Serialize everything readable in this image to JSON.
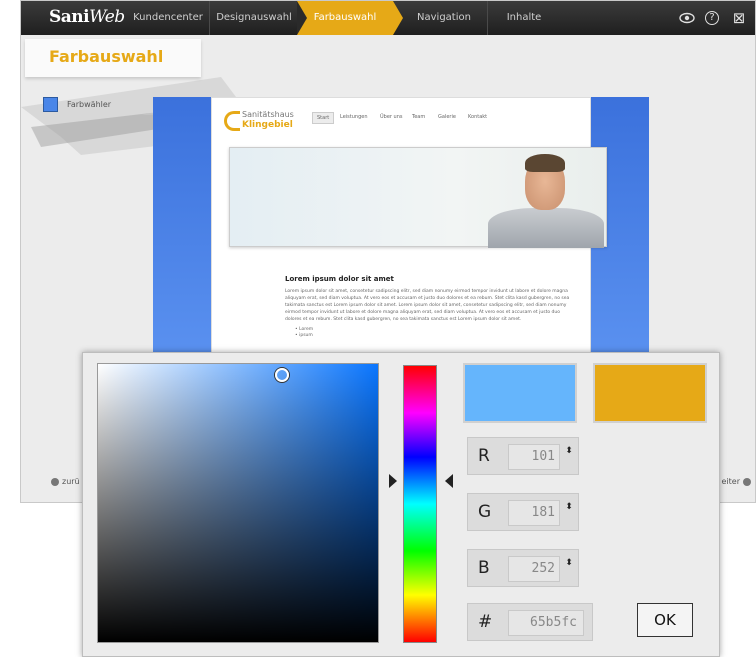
{
  "app": {
    "logo_main": "Sani",
    "logo_italic": "Web"
  },
  "nav": {
    "steps": [
      "Kundencenter",
      "Designauswahl",
      "Farbauswahl",
      "Navigation",
      "Inhalte"
    ],
    "active": "Farbauswahl"
  },
  "toolbar": {
    "preview_icon": "eye-icon",
    "help_icon": "help-icon",
    "close_icon": "close-icon",
    "help_glyph": "?",
    "close_glyph": "⊠"
  },
  "panel": {
    "title": "Farbauswahl",
    "picker_label": "Farbwähler"
  },
  "preview": {
    "site_name_line1": "Sanitätshaus",
    "site_name_line2": "Klingebiel",
    "nav_items": [
      "Start",
      "Leistungen",
      "Über uns",
      "Team",
      "Galerie",
      "Kontakt"
    ],
    "content_heading": "Lorem ipsum dolor sit amet",
    "content_text": "Lorem ipsum dolor sit amet, consetetur sadipscing elitr, sed diam nonumy eirmod tempor invidunt ut labore et dolore magna aliquyam erat, sed diam voluptua. At vero eos et accusam et justo duo dolores et ea rebum. Stet clita kasd gubergren, no sea takimata sanctus est Lorem ipsum dolor sit amet. Lorem ipsum dolor sit amet, consetetur sadipscing elitr, sed diam nonumy eirmod tempor invidunt ut labore et dolore magna aliquyam erat, sed diam voluptua. At vero eos et accusam et justo duo dolores et ea rebum. Stet clita kasd gubergren, no sea takimata sanctus est Lorem ipsum dolor sit amet.",
    "list_items": [
      "Lorem",
      "ipsum"
    ]
  },
  "footer": {
    "back_label": "zurü",
    "next_label": "eiter"
  },
  "color_picker": {
    "new_color": "#65b5fc",
    "old_color": "#e6a917",
    "r_label": "R",
    "r_value": "101",
    "g_label": "G",
    "g_value": "181",
    "b_label": "B",
    "b_value": "252",
    "hex_label": "#",
    "hex_value": "65b5fc",
    "ok_label": "OK",
    "spin_glyph": "⬍"
  },
  "colors": {
    "accent": "#e6a917",
    "topbar": "#2a2a2a",
    "preview_blue": "#3b71dc"
  }
}
